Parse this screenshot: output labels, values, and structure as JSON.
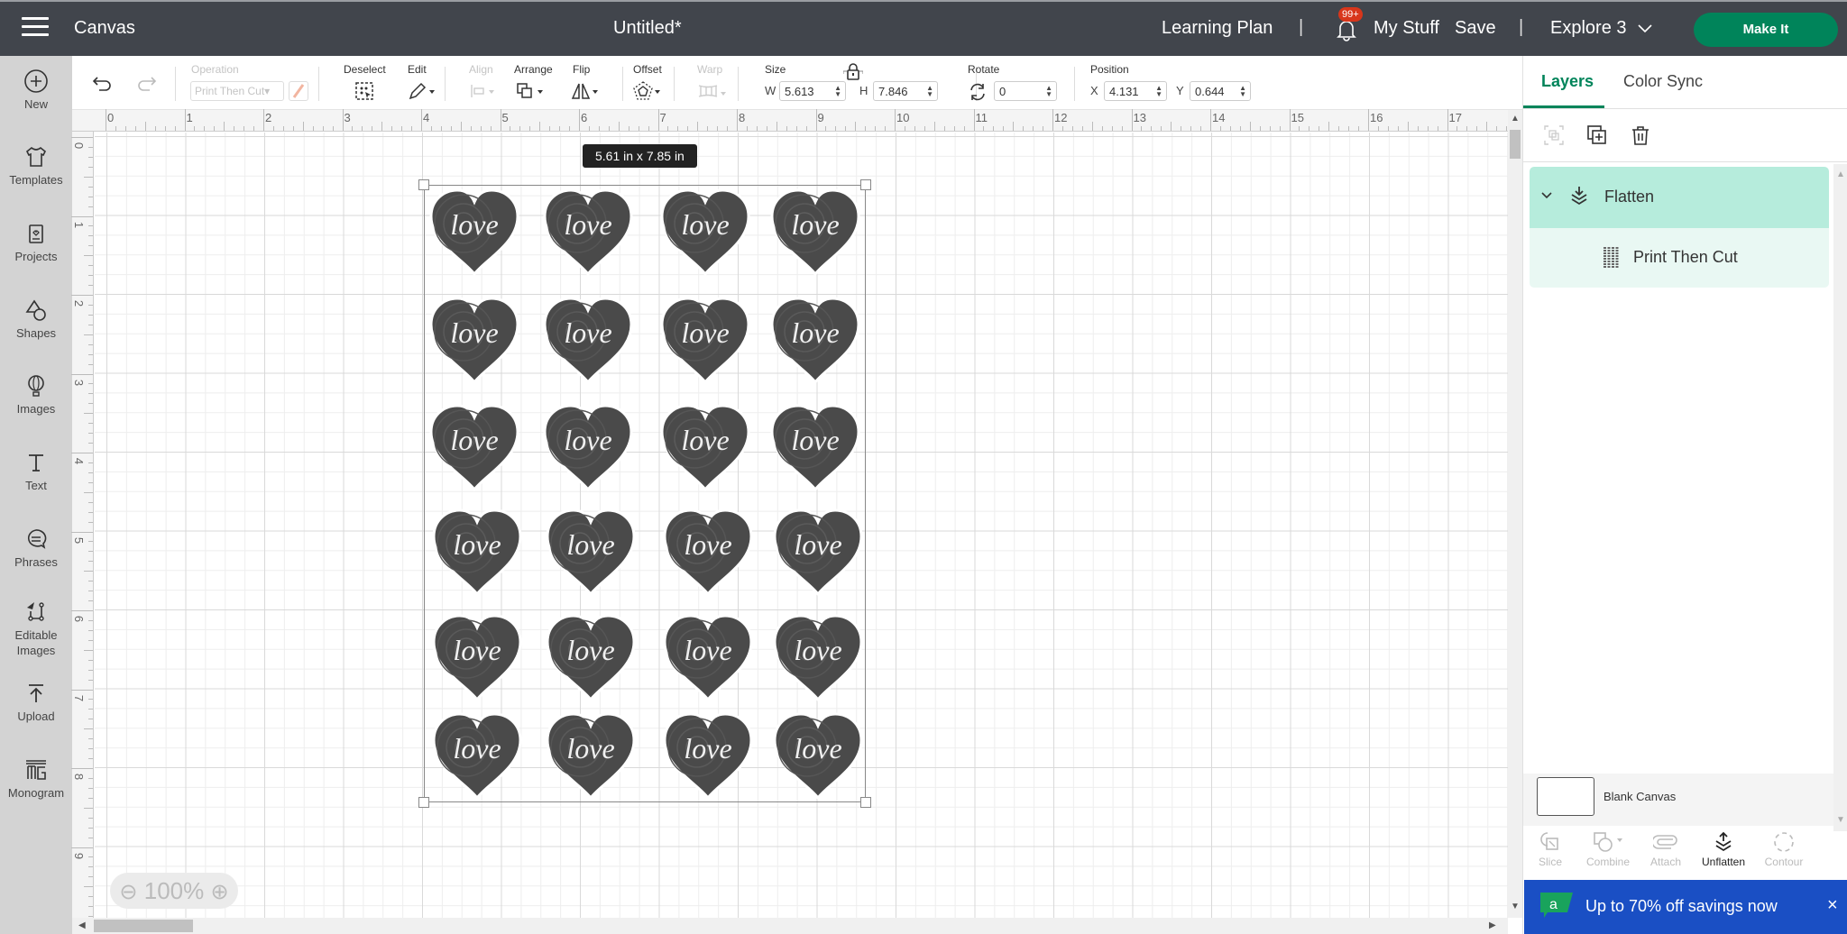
{
  "header": {
    "menu_icon": "hamburger-icon",
    "section": "Canvas",
    "doc_title": "Untitled*",
    "learning_plan": "Learning Plan",
    "separator": "|",
    "notification_badge": "99+",
    "my_stuff": "My Stuff",
    "save": "Save",
    "machine": "Explore 3",
    "make_it": "Make It"
  },
  "sidebar": {
    "items": [
      {
        "label": "New",
        "icon": "plus-circle-icon"
      },
      {
        "label": "Templates",
        "icon": "tshirt-icon"
      },
      {
        "label": "Projects",
        "icon": "project-card-icon"
      },
      {
        "label": "Shapes",
        "icon": "shapes-icon"
      },
      {
        "label": "Images",
        "icon": "balloon-icon"
      },
      {
        "label": "Text",
        "icon": "text-icon"
      },
      {
        "label": "Phrases",
        "icon": "speech-bubble-icon"
      },
      {
        "label": "Editable",
        "label2": "Images",
        "icon": "editable-images-icon"
      },
      {
        "label": "Upload",
        "icon": "upload-icon"
      },
      {
        "label": "Monogram",
        "icon": "monogram-icon"
      }
    ]
  },
  "toolbar": {
    "operation_label": "Operation",
    "operation_value": "Print Then Cut",
    "deselect": "Deselect",
    "edit": "Edit",
    "align": "Align",
    "arrange": "Arrange",
    "flip": "Flip",
    "offset": "Offset",
    "warp": "Warp",
    "size": "Size",
    "w_label": "W",
    "w_value": "5.613",
    "h_label": "H",
    "h_value": "7.846",
    "rotate": "Rotate",
    "rotate_value": "0",
    "position": "Position",
    "x_label": "X",
    "x_value": "4.131",
    "y_label": "Y",
    "y_value": "0.644"
  },
  "canvas": {
    "ruler_top": [
      "0",
      "1",
      "2",
      "3",
      "4",
      "5",
      "6",
      "7",
      "8",
      "9",
      "10",
      "11",
      "12",
      "13",
      "14",
      "15",
      "16",
      "17"
    ],
    "ruler_left": [
      "0",
      "1",
      "2",
      "3",
      "4",
      "5",
      "6",
      "7",
      "8",
      "9"
    ],
    "dimension_tooltip": "5.61  in x 7.85  in",
    "heart_text": "love",
    "heart_rows": 6,
    "heart_cols": 4,
    "zoom_level": "100%"
  },
  "panel": {
    "tabs": [
      "Layers",
      "Color Sync"
    ],
    "active_tab": "Layers",
    "layers": [
      {
        "name": "Flatten",
        "icon": "flatten-icon",
        "expanded": true
      },
      {
        "name": "Print Then Cut",
        "icon": "print-then-cut-icon"
      }
    ],
    "blank_canvas": "Blank Canvas",
    "bottom_tools": [
      "Slice",
      "Combine",
      "Attach",
      "Unflatten",
      "Contour"
    ],
    "promo_text": "Up to 70% off savings now",
    "accent": "#00845a"
  }
}
